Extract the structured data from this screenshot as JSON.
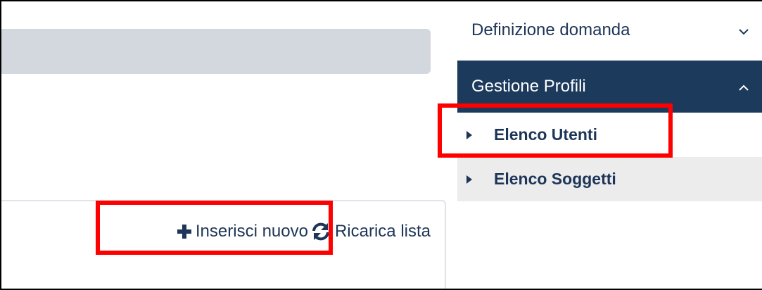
{
  "nav": {
    "items": [
      {
        "label": "Definizione domanda",
        "expanded": false
      },
      {
        "label": "Gestione Profili",
        "expanded": true,
        "children": [
          {
            "label": "Elenco Utenti"
          },
          {
            "label": "Elenco Soggetti"
          }
        ]
      }
    ]
  },
  "toolbar": {
    "add_label": "Inserisci nuovo",
    "reload_label": "Ricarica lista"
  },
  "colors": {
    "nav_active_bg": "#1b3a5c",
    "highlight": "#ff0000",
    "text": "#1d3557",
    "gray_bar": "#d3d7de",
    "sub_alt_bg": "#ececec"
  },
  "icons": [
    "plus-icon",
    "refresh-icon",
    "chevron-down-icon",
    "chevron-up-icon",
    "caret-right-icon"
  ]
}
